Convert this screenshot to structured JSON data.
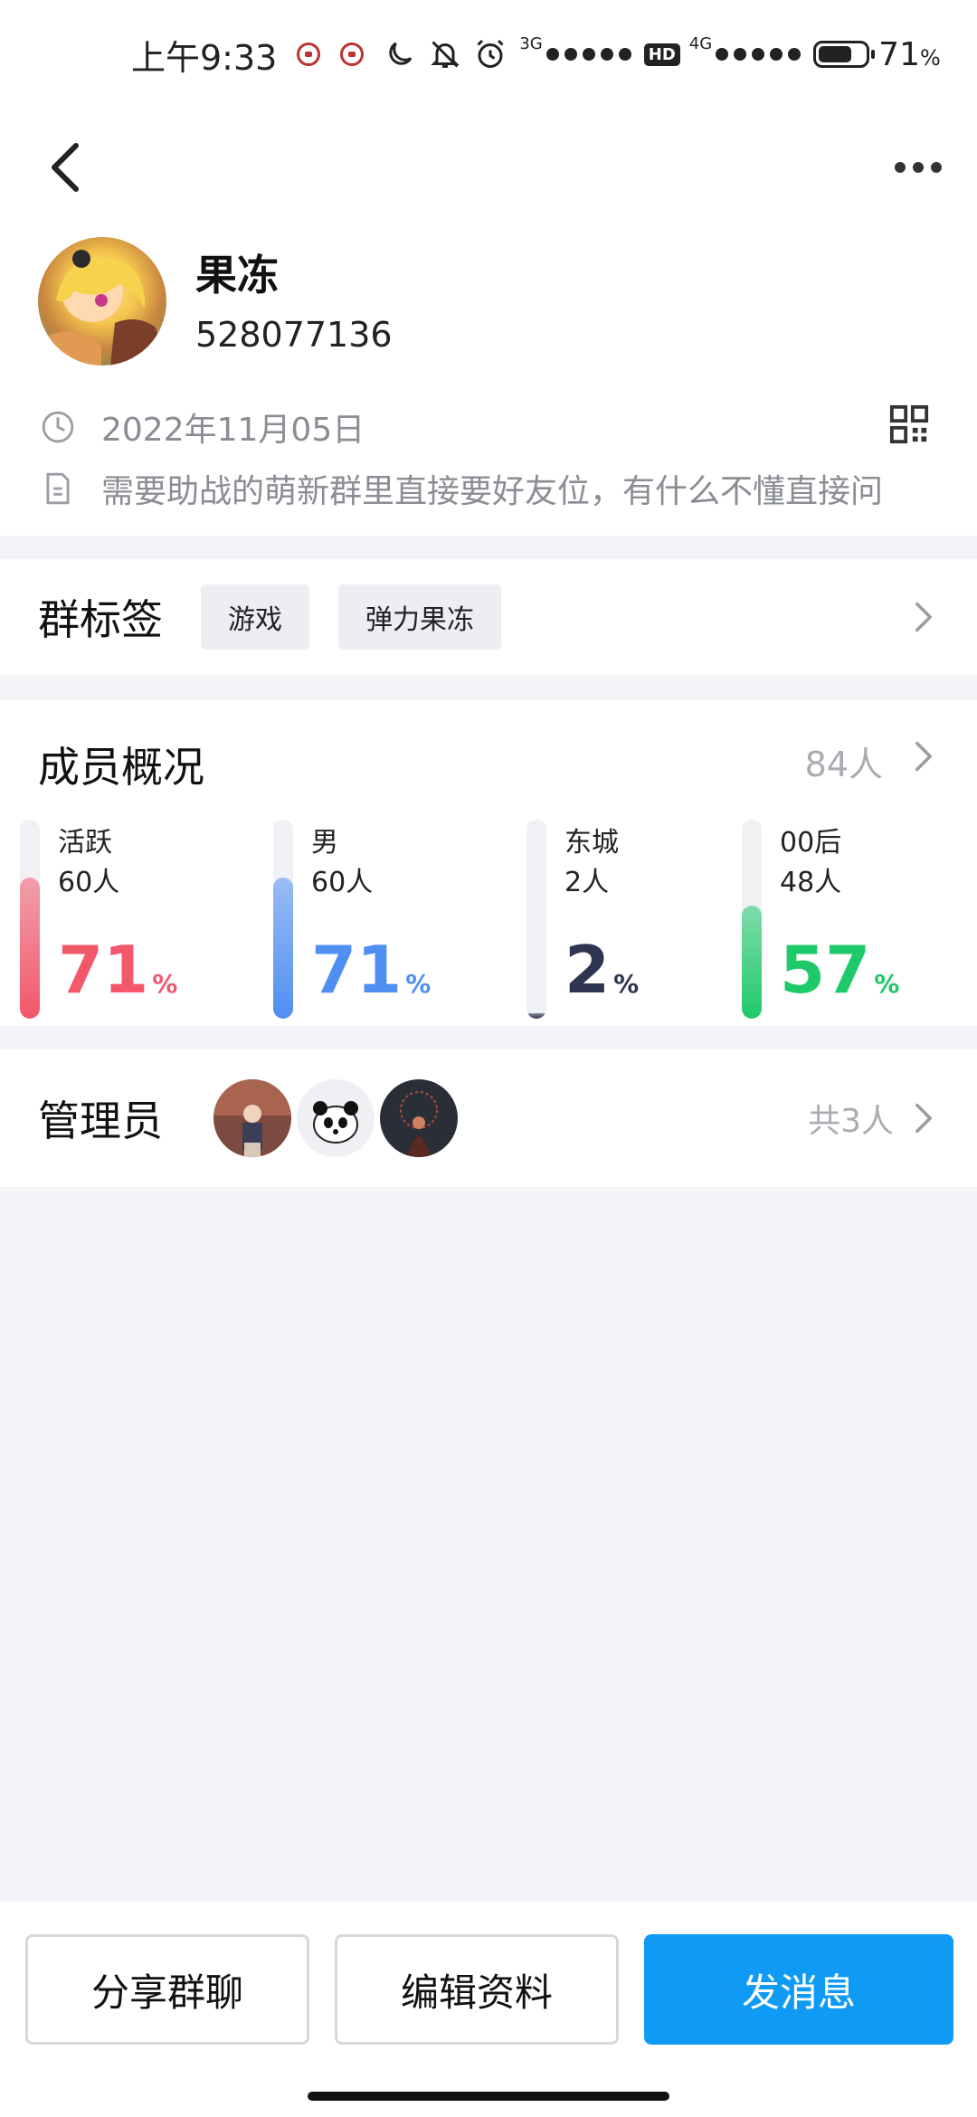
{
  "status_bar": {
    "time": "上午9:33",
    "net_3g": "3G",
    "hd_badge": "HD",
    "net_4g": "4G",
    "battery_percent": "71",
    "battery_unit": "%",
    "battery_level": 0.71
  },
  "header": {
    "back_icon": "chevron-left-icon",
    "more_icon": "more-horizontal-icon"
  },
  "group": {
    "name": "果冻",
    "id": "528077136",
    "created_date": "2022年11月05日",
    "description": "需要助战的萌新群里直接要好友位，有什么不懂直接问"
  },
  "tags": {
    "title": "群标签",
    "items": [
      "游戏",
      "弹力果冻"
    ]
  },
  "members": {
    "title": "成员概况",
    "count": "84人",
    "stats": [
      {
        "label": "活跃",
        "sub": "60人",
        "value": "71",
        "unit": "%",
        "fraction": 0.71,
        "color": "#f2576a"
      },
      {
        "label": "男",
        "sub": "60人",
        "value": "71",
        "unit": "%",
        "fraction": 0.71,
        "color": "#4f8ff2"
      },
      {
        "label": "东城",
        "sub": "2人",
        "value": "2",
        "unit": "%",
        "fraction": 0.02,
        "color": "#2d3550"
      },
      {
        "label": "00后",
        "sub": "48人",
        "value": "57",
        "unit": "%",
        "fraction": 0.57,
        "color": "#1ec96a"
      }
    ]
  },
  "admins": {
    "title": "管理员",
    "total": "共3人"
  },
  "actions": {
    "share_label": "分享群聊",
    "edit_label": "编辑资料",
    "message_label": "发消息"
  },
  "colors": {
    "primary": "#0f9bf5",
    "muted_text": "#8a8d94",
    "page_bg": "#f3f4f8"
  }
}
